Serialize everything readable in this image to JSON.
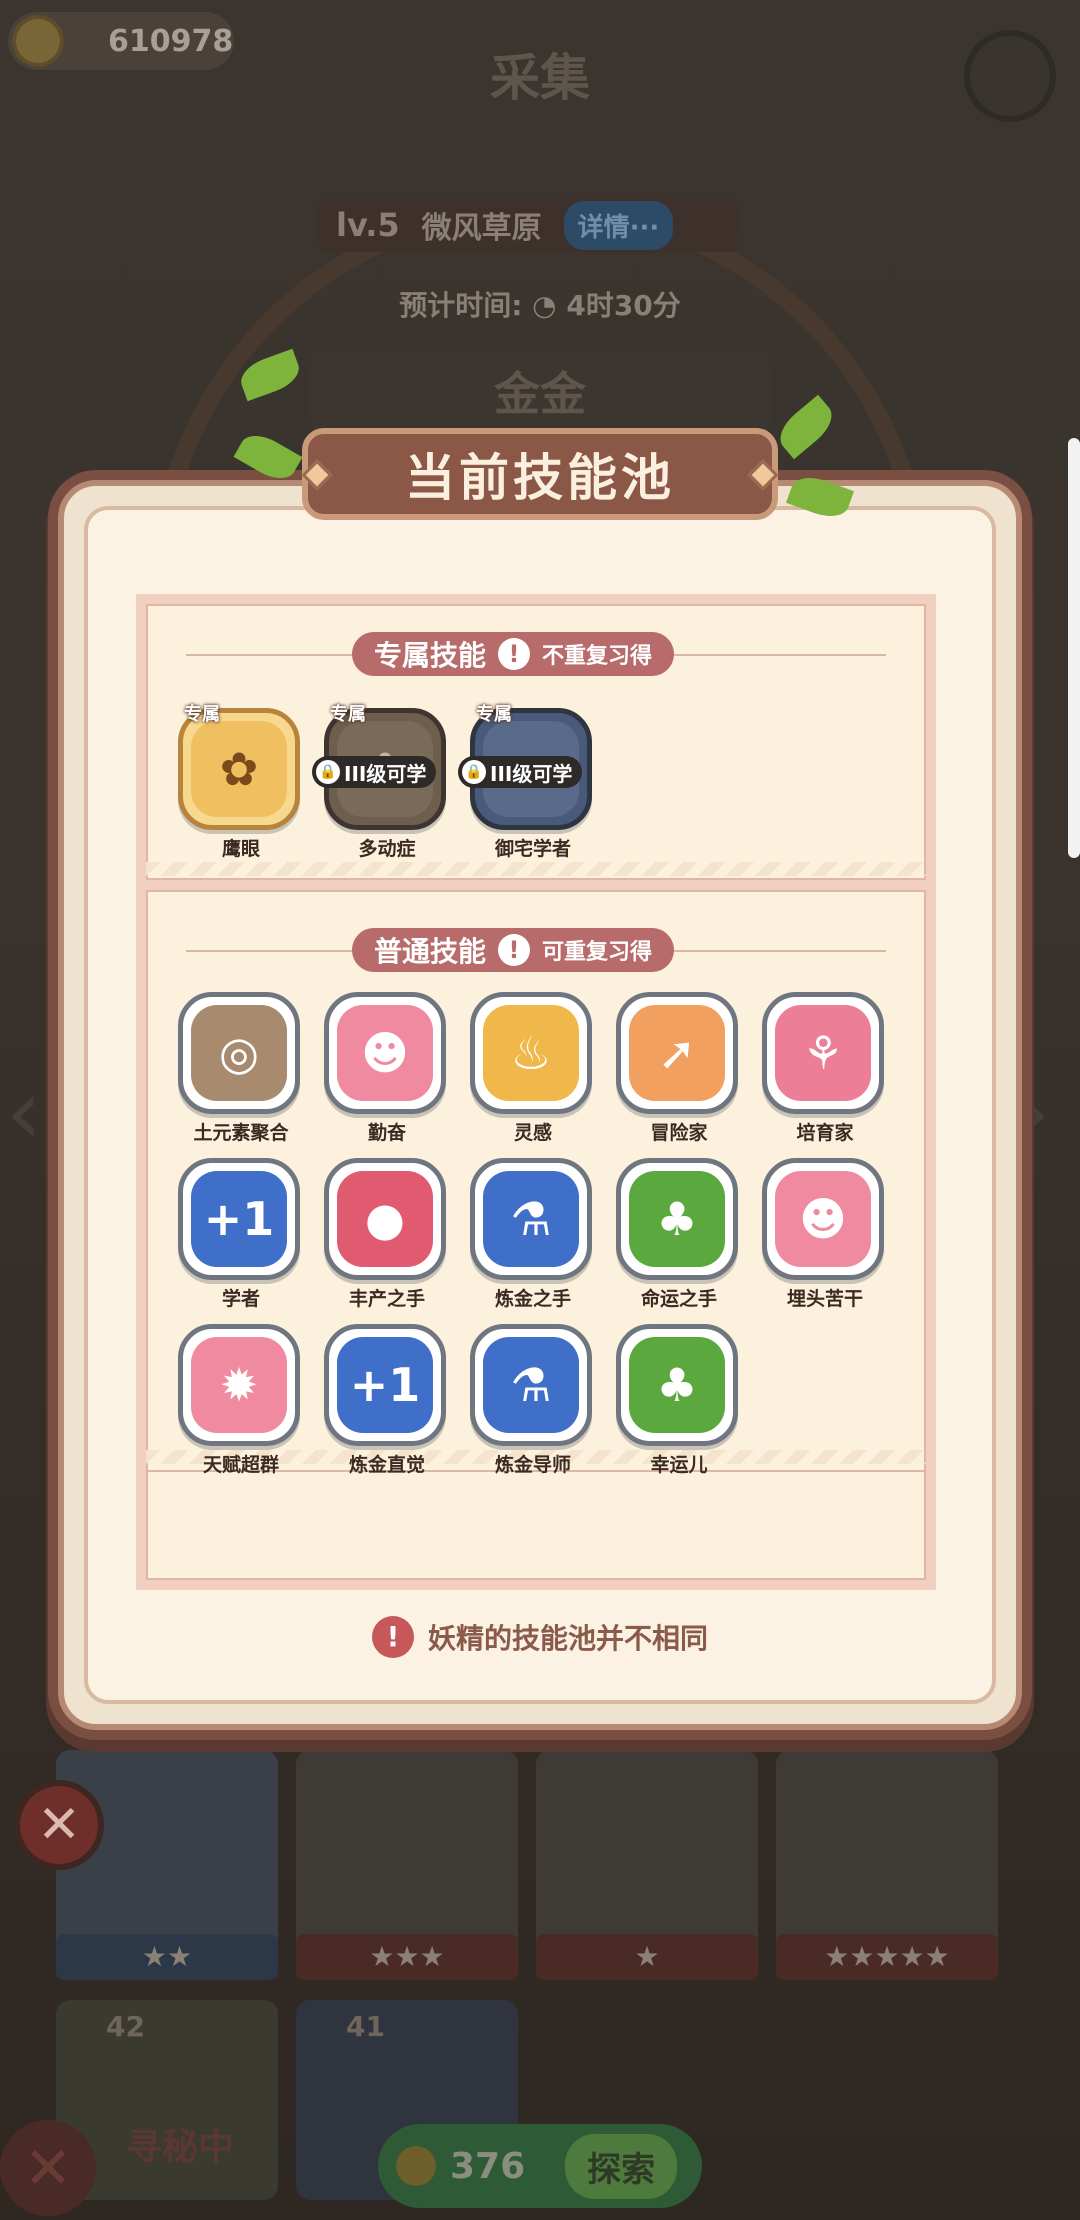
{
  "background": {
    "coins": "610978",
    "screen_title": "采集",
    "level": "lv.5",
    "map_name": "微风草原",
    "detail_button": "详情···",
    "eta_label": "预计时间:",
    "eta_value": "4时30分",
    "subtitle": "金金",
    "card_stars": [
      "★★",
      "★★★",
      "★",
      "★★★★★"
    ],
    "card_counts": [
      "42",
      "41"
    ],
    "seeking_text": "寻秘中",
    "bottom_count": "376",
    "explore_label": "探索"
  },
  "modal": {
    "title": "当前技能池",
    "exclusive": {
      "title": "专属技能",
      "note": "不重复习得",
      "items": [
        {
          "tag": "专属",
          "name": "鹰眼",
          "lock": "",
          "color": "#e8b25a",
          "icon": "bee-icon"
        },
        {
          "tag": "专属",
          "name": "多动症",
          "lock": "III级可学",
          "color": "#7a6a5a",
          "icon": "bee-icon"
        },
        {
          "tag": "专属",
          "name": "御宅学者",
          "lock": "III级可学",
          "color": "#4a5a7a",
          "icon": "scholar-icon"
        }
      ]
    },
    "normal": {
      "title": "普通技能",
      "note": "可重复习得",
      "items": [
        {
          "name": "土元素聚合",
          "color": "#a88a6e",
          "glyph": "◎"
        },
        {
          "name": "勤奋",
          "color": "#ef8aa0",
          "glyph": "☻"
        },
        {
          "name": "灵感",
          "color": "#f0b84a",
          "glyph": "♨"
        },
        {
          "name": "冒险家",
          "color": "#f2a060",
          "glyph": "➚"
        },
        {
          "name": "培育家",
          "color": "#ec7e98",
          "glyph": "⚘"
        },
        {
          "name": "学者",
          "color": "#3f6fc8",
          "glyph": "+1"
        },
        {
          "name": "丰产之手",
          "color": "#e05a70",
          "glyph": "●"
        },
        {
          "name": "炼金之手",
          "color": "#3f6fc8",
          "glyph": "⚗"
        },
        {
          "name": "命运之手",
          "color": "#5aa83e",
          "glyph": "♣"
        },
        {
          "name": "埋头苦干",
          "color": "#ef8aa0",
          "glyph": "☻"
        },
        {
          "name": "天赋超群",
          "color": "#ef8aa0",
          "glyph": "✹"
        },
        {
          "name": "炼金直觉",
          "color": "#3f6fc8",
          "glyph": "+1"
        },
        {
          "name": "炼金导师",
          "color": "#3f6fc8",
          "glyph": "⚗"
        },
        {
          "name": "幸运儿",
          "color": "#5aa83e",
          "glyph": "♣"
        }
      ]
    },
    "footer_note": "妖精的技能池并不相同"
  },
  "close_glyph": "✕"
}
